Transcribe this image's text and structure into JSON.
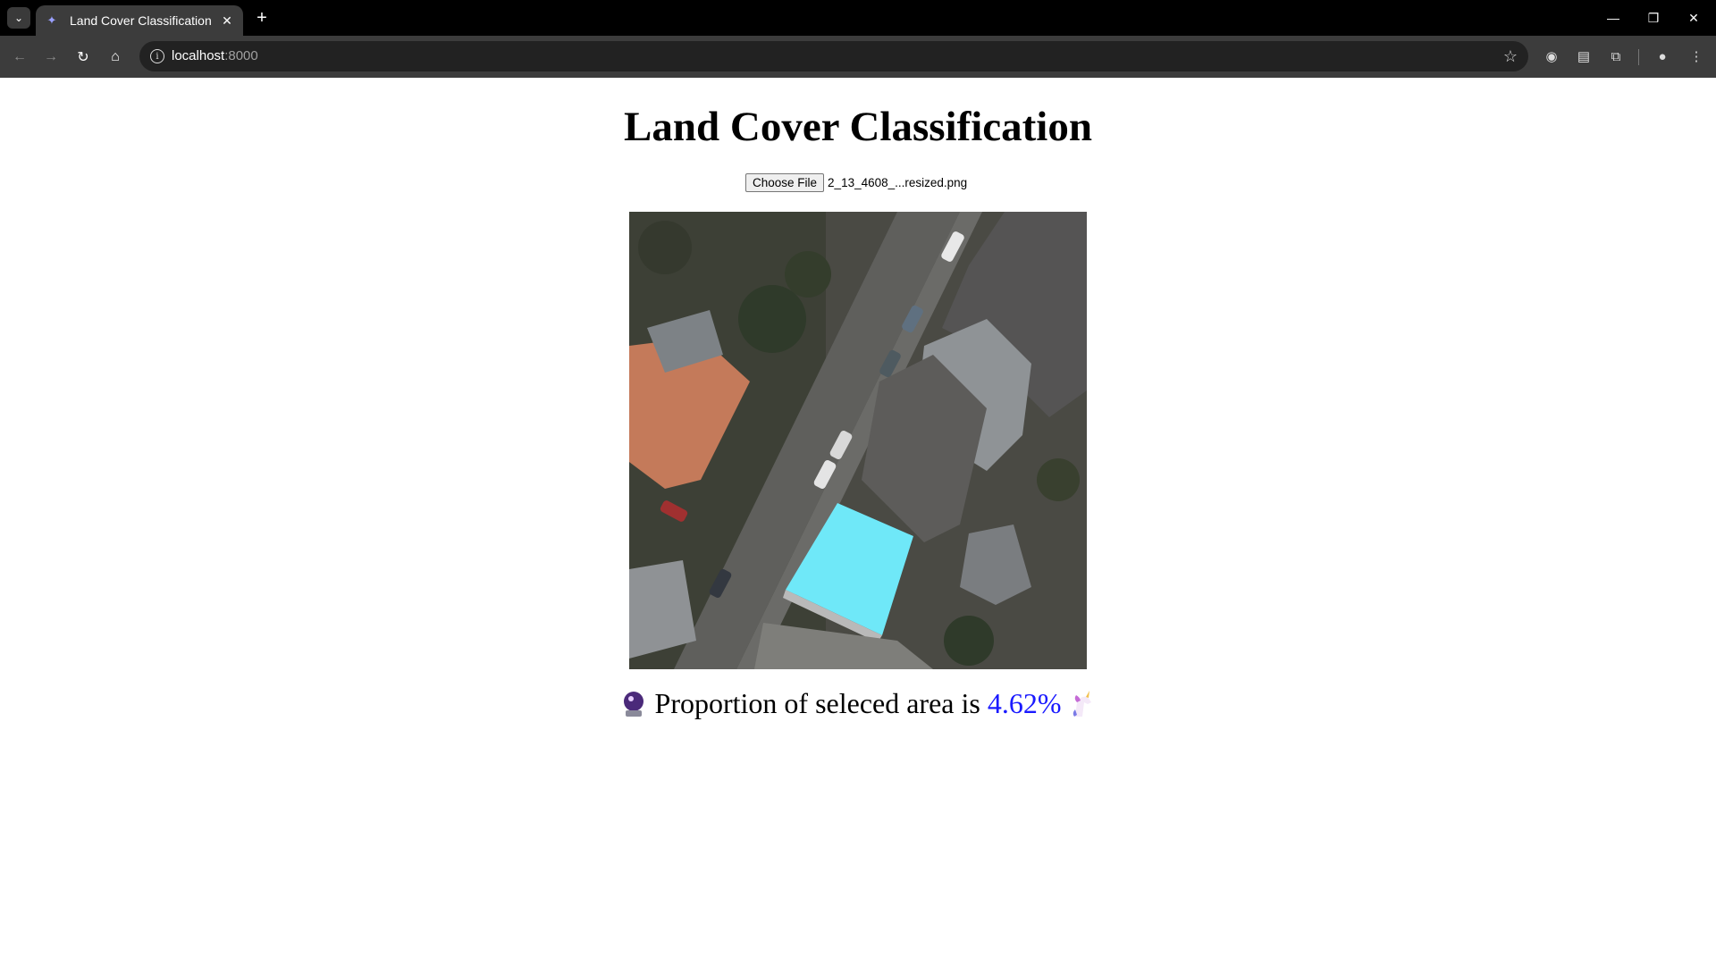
{
  "browser": {
    "tab_title": "Land Cover Classification",
    "tab_icons": {
      "search": "chevron-down-icon",
      "favicon": "sparkle-icon",
      "close": "close-icon",
      "new_tab": "plus-icon"
    },
    "url_host": "localhost",
    "url_port": ":8000",
    "window_controls": [
      "minimize-icon",
      "restore-icon",
      "close-icon"
    ],
    "toolbar_icons": [
      "chrome-icon",
      "reading-list-icon",
      "extensions-icon",
      "profile-icon",
      "menu-icon"
    ]
  },
  "page": {
    "title": "Land Cover Classification",
    "file_input": {
      "button_label": "Choose File",
      "file_name": "2_13_4608_...resized.png"
    },
    "result": {
      "prefix": "Proportion of seleced area is",
      "percentage": "4.62%",
      "left_emoji": "crystal-ball-icon",
      "right_emoji": "unicorn-icon"
    },
    "image_alt_kind": "aerial-image-with-highlighted-roof",
    "highlight_color": "#6fe8f8"
  }
}
